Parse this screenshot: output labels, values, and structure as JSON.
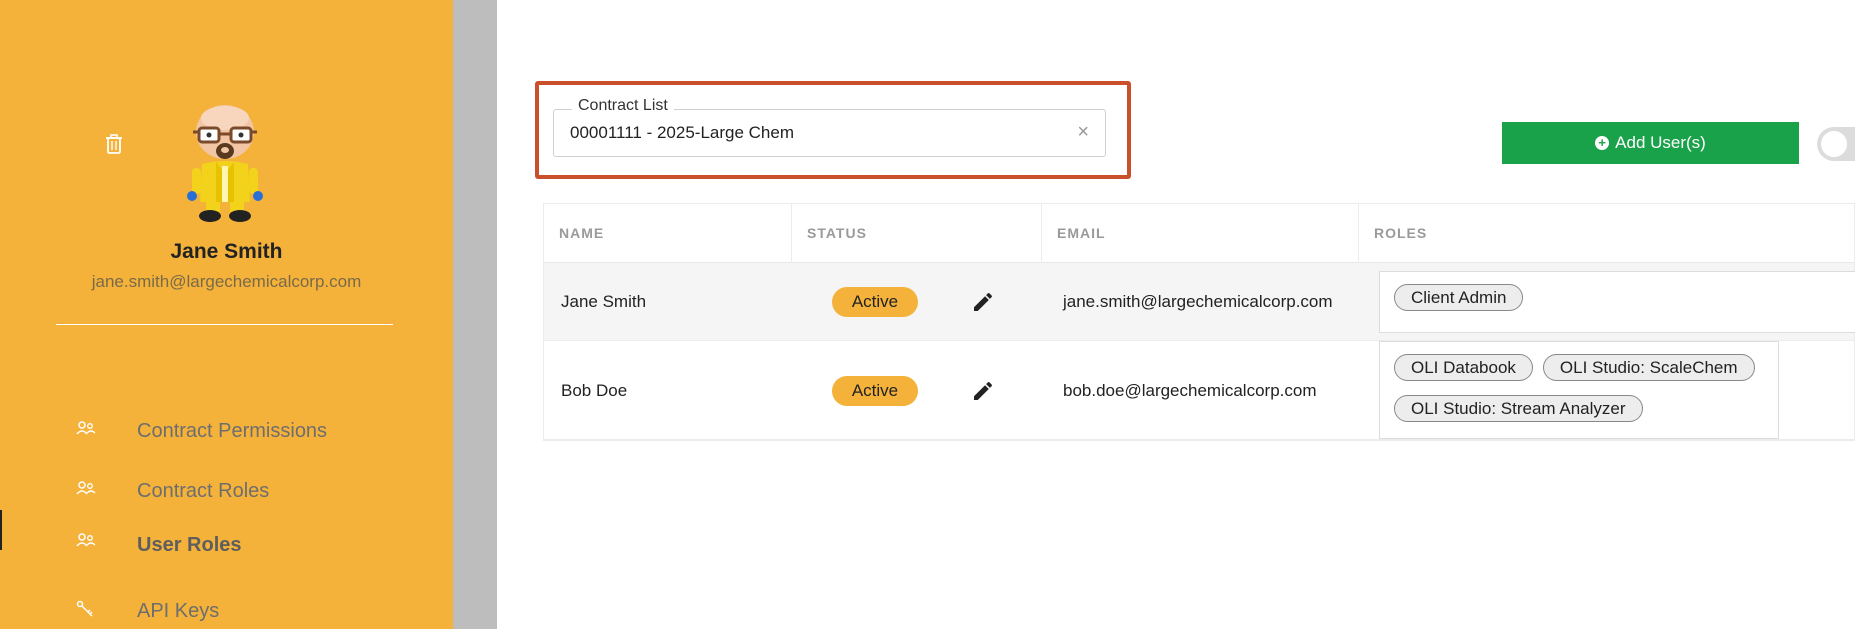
{
  "profile": {
    "name": "Jane Smith",
    "email": "jane.smith@largechemicalcorp.com"
  },
  "nav": {
    "items": [
      {
        "label": "Contract Permissions"
      },
      {
        "label": "Contract Roles"
      },
      {
        "label": "User Roles",
        "active": true
      },
      {
        "label": "API Keys"
      }
    ]
  },
  "contract": {
    "legend": "Contract List",
    "value": "00001111 - 2025-Large Chem",
    "clear": "×"
  },
  "toolbar": {
    "add_users_label": "Add User(s)"
  },
  "table": {
    "headers": [
      "NAME",
      "STATUS",
      "EMAIL",
      "ROLES"
    ],
    "rows": [
      {
        "name": "Jane Smith",
        "status": "Active",
        "email": "jane.smith@largechemicalcorp.com",
        "roles": [
          "Client Admin"
        ]
      },
      {
        "name": "Bob Doe",
        "status": "Active",
        "email": "bob.doe@largechemicalcorp.com",
        "roles": [
          "OLI Databook",
          "OLI Studio: ScaleChem",
          "OLI Studio: Stream Analyzer"
        ]
      }
    ]
  },
  "colors": {
    "sidebar": "#f4b23a",
    "accent_green": "#1aa24a",
    "highlight_border": "#c9502a",
    "status_active": "#f4b23a"
  },
  "icons": {
    "trash": "trash-icon",
    "nav": "users-icon",
    "api": "key-icon",
    "edit": "pencil-icon",
    "add": "plus-circle-icon"
  }
}
